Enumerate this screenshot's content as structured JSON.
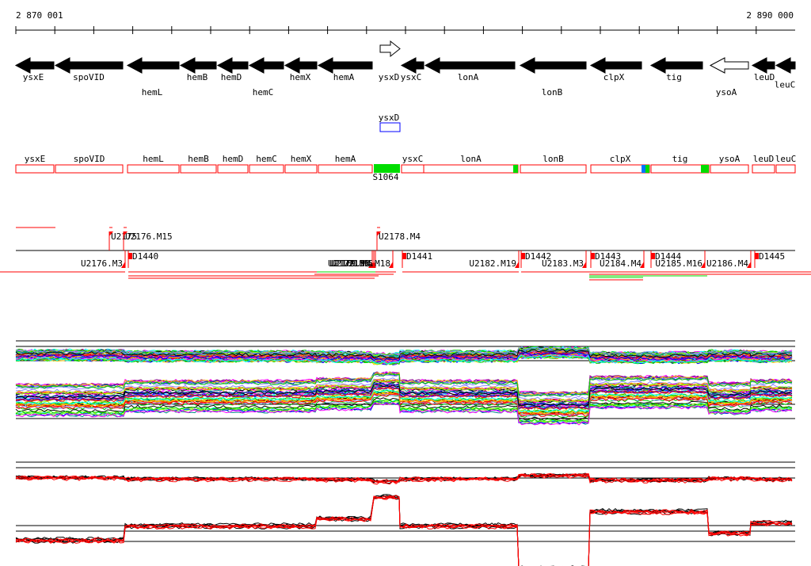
{
  "ruler": {
    "start_label": "2 870 001",
    "end_label": "2 890 000"
  },
  "genes": [
    "ysxE",
    "spoVID",
    "hemL",
    "hemB",
    "hemD",
    "hemC",
    "hemX",
    "hemA",
    "ysxD",
    "ysxC",
    "lonA",
    "lonB",
    "clpX",
    "tig",
    "ysoA",
    "leuD",
    "leuC"
  ],
  "ncrna": {
    "label": "ysxD"
  },
  "operon_boxes": [
    "ysxE",
    "spoVID",
    "hemL",
    "hemB",
    "hemD",
    "hemC",
    "hemX",
    "hemA",
    "ysxC",
    "lonA",
    "lonB",
    "clpX",
    "tig",
    "ysoA",
    "leuD",
    "leuC"
  ],
  "segment_label": "S1064",
  "upper_markers": [
    "U2175",
    "U2176.M15",
    "U2178.M4"
  ],
  "lower_markers": [
    "U2176.M3",
    "D1440",
    "U2177.M8",
    "U2179.M4",
    "U2180.M5",
    "U2181.M18",
    "D1441",
    "U2182.M19",
    "D1442",
    "U2183.M3",
    "D1443",
    "U2184.M4",
    "D1444",
    "U2185.M16",
    "U2186.M4",
    "D1445"
  ],
  "colors": {
    "gene": "#000000",
    "marker": "#ff0000",
    "highlight": "#00dd00",
    "ncrna": "#0000ff"
  }
}
